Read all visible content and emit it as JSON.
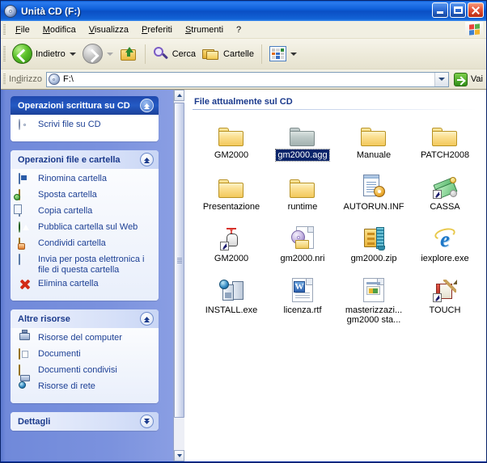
{
  "window": {
    "title": "Unità CD (F:)",
    "title_icon": "cd-drive-icon",
    "buttons": {
      "minimize": "minimize-button",
      "maximize": "maximize-button",
      "close": "close-button"
    }
  },
  "menubar": {
    "items": [
      {
        "label": "File",
        "accel": "F"
      },
      {
        "label": "Modifica",
        "accel": "M"
      },
      {
        "label": "Visualizza",
        "accel": "V"
      },
      {
        "label": "Preferiti",
        "accel": "P"
      },
      {
        "label": "Strumenti",
        "accel": "S"
      },
      {
        "label": "?",
        "accel": ""
      }
    ],
    "brand_icon": "windows-flag-icon"
  },
  "toolbar": {
    "back_label": "Indietro",
    "forward_label": "",
    "up_label": "",
    "search_label": "Cerca",
    "folders_label": "Cartelle",
    "views_label": ""
  },
  "addressbar": {
    "label": "Indirizzo",
    "accel": "d",
    "value": "F:\\",
    "icon": "cd-drive-icon",
    "go_label": "Vai"
  },
  "sidebar": {
    "panels": [
      {
        "title": "Operazioni scrittura su CD",
        "style": "dark",
        "collapse_state": "expanded",
        "items": [
          {
            "label": "Scrivi file su CD",
            "icon": "burn-cd-icon"
          }
        ]
      },
      {
        "title": "Operazioni file e cartella",
        "style": "light",
        "collapse_state": "expanded",
        "items": [
          {
            "label": "Rinomina cartella",
            "icon": "rename-icon"
          },
          {
            "label": "Sposta cartella",
            "icon": "move-folder-icon"
          },
          {
            "label": "Copia cartella",
            "icon": "copy-folder-icon"
          },
          {
            "label": "Pubblica cartella sul Web",
            "icon": "publish-web-icon"
          },
          {
            "label": "Condividi cartella",
            "icon": "share-folder-icon"
          },
          {
            "label": "Invia per posta elettronica i file di questa cartella",
            "icon": "email-icon"
          },
          {
            "label": "Elimina cartella",
            "icon": "delete-icon"
          }
        ]
      },
      {
        "title": "Altre risorse",
        "style": "light",
        "collapse_state": "expanded",
        "items": [
          {
            "label": "Risorse del computer",
            "icon": "my-computer-icon"
          },
          {
            "label": "Documenti",
            "icon": "documents-icon"
          },
          {
            "label": "Documenti condivisi",
            "icon": "shared-documents-icon"
          },
          {
            "label": "Risorse di rete",
            "icon": "network-icon"
          }
        ]
      },
      {
        "title": "Dettagli",
        "style": "light",
        "collapse_state": "collapsed",
        "items": []
      }
    ]
  },
  "files": {
    "group_header": "File attualmente sul CD",
    "items": [
      {
        "name": "GM2000",
        "icon": "folder-icon",
        "selected": false
      },
      {
        "name": "gm2000.agg",
        "icon": "folder-icon-gray",
        "selected": true
      },
      {
        "name": "Manuale",
        "icon": "folder-icon",
        "selected": false
      },
      {
        "name": "PATCH2008",
        "icon": "folder-icon",
        "selected": false
      },
      {
        "name": "Presentazione",
        "icon": "folder-icon",
        "selected": false
      },
      {
        "name": "runtime",
        "icon": "folder-icon",
        "selected": false
      },
      {
        "name": "AUTORUN.INF",
        "icon": "inf-file-icon",
        "selected": false
      },
      {
        "name": "CASSA",
        "icon": "cash-shortcut-icon",
        "selected": false
      },
      {
        "name": "GM2000",
        "icon": "click-shortcut-icon",
        "selected": false
      },
      {
        "name": "gm2000.nri",
        "icon": "nero-file-icon",
        "selected": false
      },
      {
        "name": "gm2000.zip",
        "icon": "zip-file-icon",
        "selected": false
      },
      {
        "name": "iexplore.exe",
        "icon": "internet-explorer-icon",
        "selected": false
      },
      {
        "name": "INSTALL.exe",
        "icon": "setup-exe-icon",
        "selected": false
      },
      {
        "name": "licenza.rtf",
        "icon": "word-document-icon",
        "selected": false
      },
      {
        "name": "masterizzazi... gm2000 sta...",
        "icon": "thumbnail-document-icon",
        "selected": false
      },
      {
        "name": "TOUCH",
        "icon": "touch-shortcut-icon",
        "selected": false
      }
    ]
  },
  "colors": {
    "titlebar_blue": "#0A5AD0",
    "sidebar_blue": "#7B92DE",
    "panel_header_dark": "#1F48AD",
    "link_text": "#1C3F94",
    "selection_blue": "#0A246A",
    "folder_yellow": "#F3C95C"
  }
}
